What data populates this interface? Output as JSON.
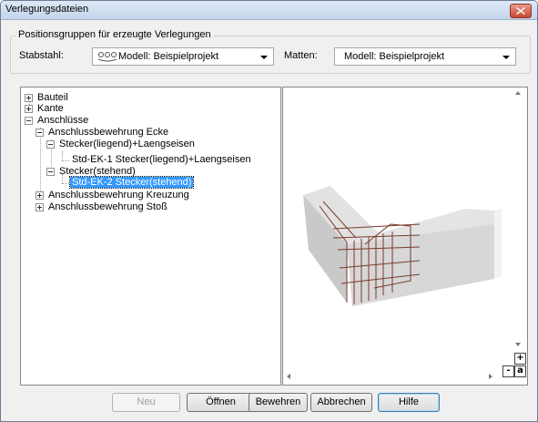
{
  "window": {
    "title": "Verlegungsdateien"
  },
  "group": {
    "legend": "Positionsgruppen für erzeugte Verlegungen",
    "stabstahl_label": "Stabstahl:",
    "stabstahl_value": "Modell: Beispielprojekt",
    "matten_label": "Matten:",
    "matten_value": "Modell: Beispielprojekt"
  },
  "tree": {
    "bauteil": "Bauteil",
    "kante": "Kante",
    "anschluesse": "Anschlüsse",
    "ecke": "Anschlussbewehrung Ecke",
    "stecker_liegend": "Stecker(liegend)+Laengseisen",
    "std_ek1": "Std-EK-1 Stecker(liegend)+Laengseisen",
    "stecker_stehend": "Stecker(stehend)",
    "std_ek2": "Std-EK-2 Stecker(stehend)",
    "kreuzung": "Anschlussbewehrung Kreuzung",
    "stoss": "Anschlussbewehrung Stoß"
  },
  "preview": {
    "zoom_in": "+",
    "zoom_out": "-",
    "zoom_all": "a"
  },
  "buttons": {
    "neu": "Neu",
    "oeffnen": "Öffnen",
    "bewehren": "Bewehren",
    "abbrechen": "Abbrechen",
    "hilfe": "Hilfe"
  }
}
